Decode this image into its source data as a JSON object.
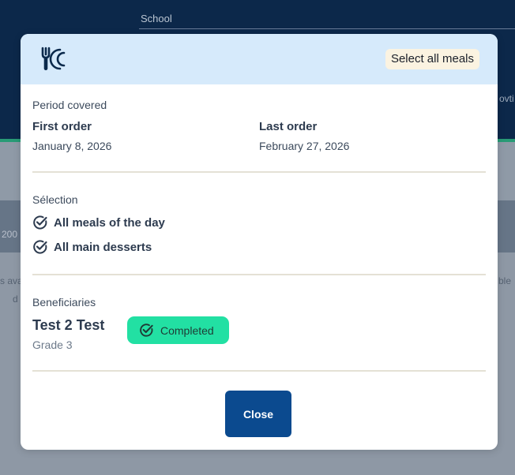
{
  "background": {
    "school_label": "School",
    "fragments": [
      "200",
      "s ava",
      "d",
      "ble",
      "ovti"
    ]
  },
  "modal": {
    "header": {
      "icon": "utensils-icon",
      "select_all_label": "Select all meals"
    },
    "period": {
      "label": "Period covered",
      "first_order_title": "First order",
      "first_order_value": "January 8, 2026",
      "last_order_title": "Last order",
      "last_order_value": "February 27, 2026"
    },
    "selection": {
      "label": "Sélection",
      "items": [
        {
          "label": "All meals of the day",
          "icon": "check-circle-icon"
        },
        {
          "label": "All main desserts",
          "icon": "check-circle-icon"
        }
      ]
    },
    "beneficiaries": {
      "label": "Beneficiaries",
      "name": "Test 2 Test",
      "grade": "Grade 3",
      "status": "Completed",
      "status_icon": "check-circle-icon"
    },
    "close_label": "Close"
  },
  "colors": {
    "header_bg": "#d6eafb",
    "select_all_bg": "#fbf3e1",
    "status_green": "#22e0a3",
    "close_button": "#0b4a8f",
    "background_navy": "#0b2a4c"
  }
}
